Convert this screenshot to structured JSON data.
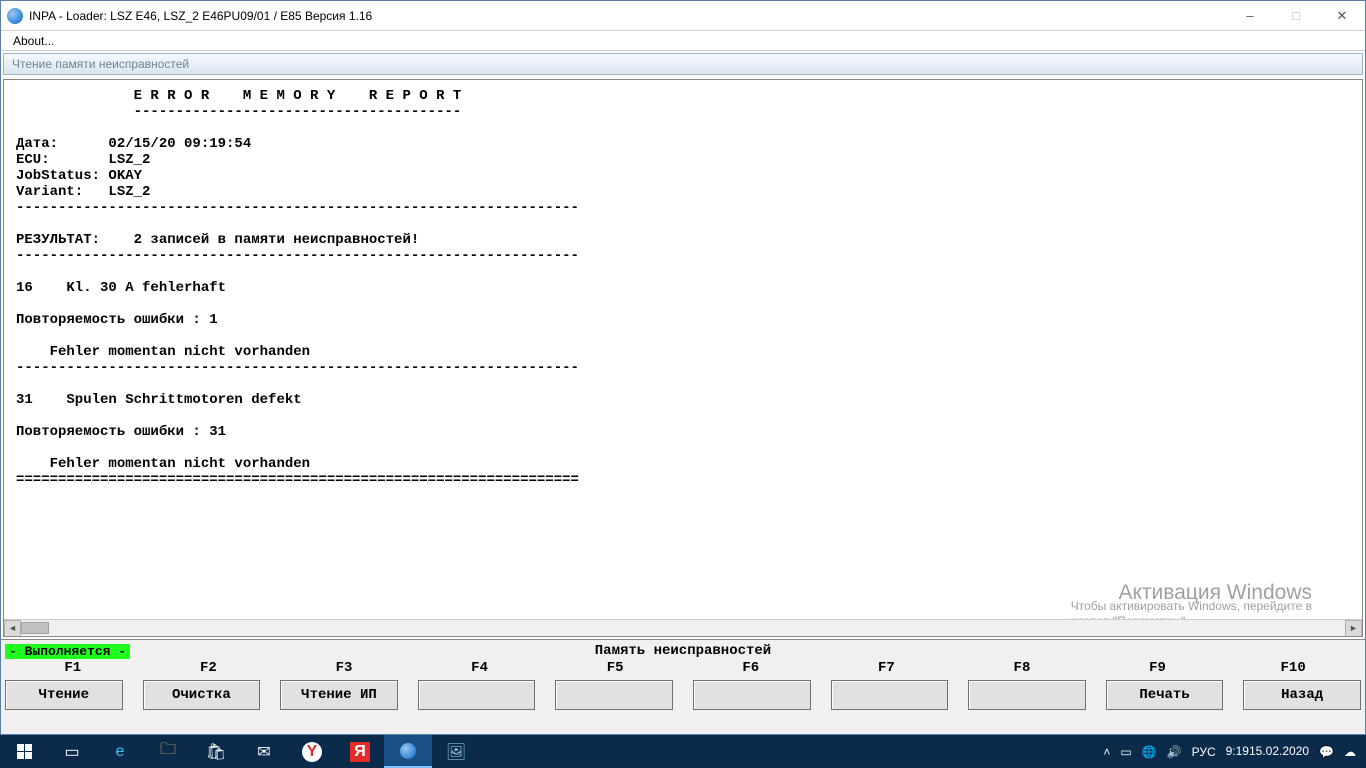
{
  "window": {
    "title": "INPA - Loader:  LSZ E46, LSZ_2 E46PU09/01 / E85 Версия 1.16"
  },
  "menu": {
    "about": "About..."
  },
  "subheader": "Чтение памяти неисправностей",
  "report": {
    "header": "              E R R O R    M E M O R Y    R E P O R T",
    "hr1": "              ---------------------------------------",
    "blank": "",
    "date": "Дата:      02/15/20 09:19:54",
    "ecu": "ECU:       LSZ_2",
    "jobstat": "JobStatus: OKAY",
    "variant": "Variant:   LSZ_2",
    "sep": "-------------------------------------------------------------------",
    "result": "РЕЗУЛЬТАТ:    2 записей в памяти неисправностей!",
    "err1": "16    Kl. 30 A fehlerhaft",
    "err1_rep": "Повторяемость ошибки : 1",
    "err1_stat": "    Fehler momentan nicht vorhanden",
    "err2": "31    Spulen Schrittmotoren defekt",
    "err2_rep": "Повторяемость ошибки : 31",
    "err2_stat": "    Fehler momentan nicht vorhanden",
    "end": "==================================================================="
  },
  "status": {
    "badge": "- Выполняется -",
    "center": "Память неисправностей"
  },
  "fkeys": {
    "labels": [
      "F1",
      "F2",
      "F3",
      "F4",
      "F5",
      "F6",
      "F7",
      "F8",
      "F9",
      "F10"
    ],
    "buttons": [
      "Чтение",
      "Очистка",
      "Чтение ИП",
      "",
      "",
      "",
      "",
      "",
      "Печать",
      "Назад"
    ]
  },
  "watermark": {
    "title": "Активация Windows",
    "sub1": "Чтобы активировать Windows, перейдите в",
    "sub2": "раздел \"Параметры\"."
  },
  "tray": {
    "lang": "РУС",
    "time": "9:19",
    "date": "15.02.2020"
  }
}
